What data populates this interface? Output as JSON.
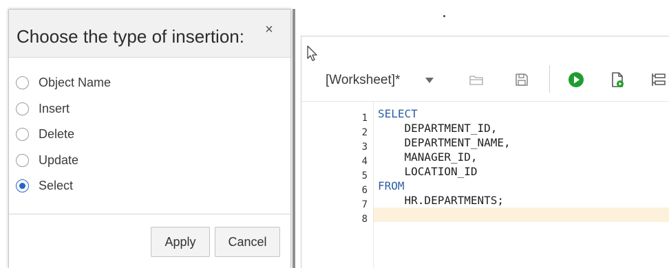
{
  "dialog": {
    "title": "Choose the type of insertion:",
    "close_glyph": "×",
    "options": [
      {
        "label": "Object Name",
        "checked": false
      },
      {
        "label": "Insert",
        "checked": false
      },
      {
        "label": "Delete",
        "checked": false
      },
      {
        "label": "Update",
        "checked": false
      },
      {
        "label": "Select",
        "checked": true
      }
    ],
    "apply_label": "Apply",
    "cancel_label": "Cancel"
  },
  "worksheet": {
    "title": "[Worksheet]*",
    "toolbar_icons": [
      "open-folder-icon",
      "save-icon",
      "run-statement-icon",
      "run-script-icon",
      "explain-plan-icon"
    ],
    "run_color": "#1f9d2f",
    "code_lines": [
      {
        "n": "1",
        "text": "SELECT",
        "kind": "keyword"
      },
      {
        "n": "2",
        "text": "    DEPARTMENT_ID,",
        "kind": "plain"
      },
      {
        "n": "3",
        "text": "    DEPARTMENT_NAME,",
        "kind": "plain"
      },
      {
        "n": "4",
        "text": "    MANAGER_ID,",
        "kind": "plain"
      },
      {
        "n": "5",
        "text": "    LOCATION_ID",
        "kind": "plain"
      },
      {
        "n": "6",
        "text": "FROM",
        "kind": "keyword"
      },
      {
        "n": "7",
        "text": "    HR.DEPARTMENTS;",
        "kind": "plain"
      },
      {
        "n": "8",
        "text": "",
        "kind": "plain",
        "active": true
      }
    ]
  }
}
